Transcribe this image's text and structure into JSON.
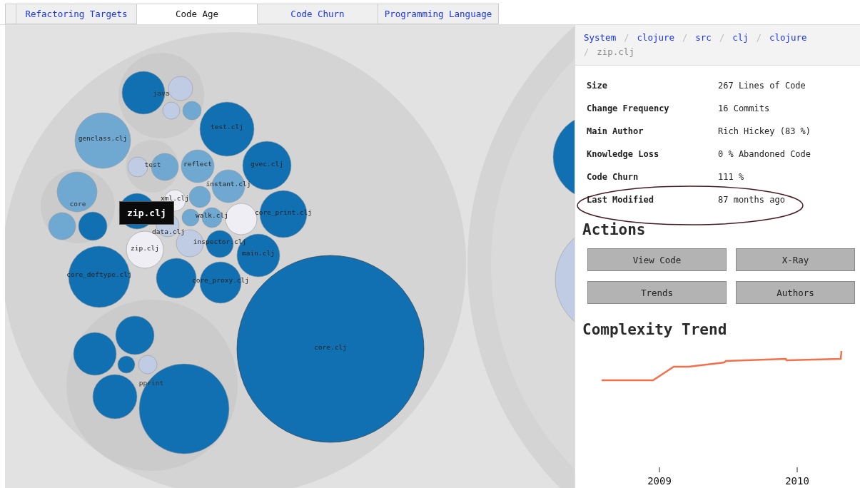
{
  "tabs": [
    {
      "label": "Refactoring Targets",
      "selected": false
    },
    {
      "label": "Code Age",
      "selected": true
    },
    {
      "label": "Code Churn",
      "selected": false
    },
    {
      "label": "Programming Language",
      "selected": false
    }
  ],
  "packages": [
    {
      "label": "java"
    },
    {
      "label": "test"
    },
    {
      "label": "core"
    },
    {
      "label": "pprint"
    }
  ],
  "circles": [
    {
      "color": "#1170b2"
    },
    {
      "color": "#bfcce4"
    },
    {
      "color": "#bfcce4"
    },
    {
      "color": "#6fa8d1"
    },
    {
      "label": "test.clj",
      "color": "#1170b2"
    },
    {
      "label": "genclass.clj",
      "color": "#6fa8d1"
    },
    {
      "color": "#bfcce4"
    },
    {
      "color": "#6fa8d1"
    },
    {
      "label": "reflect",
      "color": "#6fa8d1"
    },
    {
      "label": "gvec.clj",
      "color": "#1170b2"
    },
    {
      "label": "instant.clj",
      "color": "#6fa8d1"
    },
    {
      "color": "#6fa8d1"
    },
    {
      "color": "#6fa8d1"
    },
    {
      "color": "#1170b2"
    },
    {
      "label": "xml.clj",
      "color": "#efeef4"
    },
    {
      "color": "#6fa8d1"
    },
    {
      "color": "#1170b2"
    },
    {
      "label": "data.clj",
      "color": "#bfcce4"
    },
    {
      "color": "#6fa8d1"
    },
    {
      "label": "walk.clj",
      "color": "#6fa8d1"
    },
    {
      "color": "#efeef4"
    },
    {
      "label": "core_print.clj",
      "color": "#1170b2"
    },
    {
      "label": "zip.clj",
      "color": "#efeef4"
    },
    {
      "color": "#bfcce4"
    },
    {
      "label": "inspector.clj",
      "color": "#1170b2"
    },
    {
      "label": "main.clj",
      "color": "#1170b2"
    },
    {
      "label": "core_deftype.clj",
      "color": "#1170b2"
    },
    {
      "color": "#1170b2"
    },
    {
      "label": "core_proxy.clj",
      "color": "#1170b2"
    },
    {
      "label": "core.clj",
      "color": "#1170b2"
    },
    {
      "color": "#1170b2"
    },
    {
      "color": "#1170b2"
    },
    {
      "color": "#1170b2"
    },
    {
      "color": "#bfcce4"
    },
    {
      "color": "#1170b2"
    },
    {
      "color": "#1170b2"
    },
    {
      "color": "#1170b2"
    },
    {
      "color": "#bfcce4"
    }
  ],
  "tooltip": {
    "text": "zip.clj"
  },
  "breadcrumb": [
    {
      "label": "System"
    },
    {
      "separator": "/",
      "label": "clojure"
    },
    {
      "separator": "/",
      "label": "src"
    },
    {
      "separator": "/",
      "label": "clj"
    },
    {
      "separator": "/",
      "label": "clojure"
    },
    {
      "separator": "/",
      "label": "zip.clj",
      "current": true
    }
  ],
  "details": [
    {
      "label": "Size",
      "value": "267 Lines of Code",
      "highlighted": false
    },
    {
      "label": "Change Frequency",
      "value": "16 Commits",
      "highlighted": false
    },
    {
      "label": "Main Author",
      "value": "Rich Hickey (83 %)",
      "highlighted": false
    },
    {
      "label": "Knowledge Loss",
      "value": "0 % Abandoned Code",
      "highlighted": false
    },
    {
      "label": "Code Churn",
      "value": "111 %",
      "highlighted": false
    },
    {
      "label": "Last Modified",
      "value": "87 months ago",
      "highlighted": true
    }
  ],
  "actions": {
    "title": "Actions",
    "buttons": [
      "View Code",
      "X-Ray",
      "Trends",
      "Authors"
    ]
  },
  "complexity_trend": {
    "title": "Complexity Trend",
    "x_ticks": [
      "2009",
      "2010"
    ]
  }
}
